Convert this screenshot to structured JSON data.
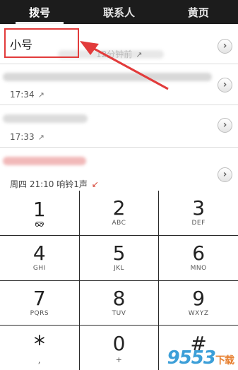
{
  "tabs": [
    {
      "label": "拨号"
    },
    {
      "label": "联系人"
    },
    {
      "label": "黄页"
    }
  ],
  "calls": [
    {
      "name": "小号",
      "detail": "12分钟前",
      "direction": "outgoing"
    },
    {
      "name": "",
      "detail": "17:34",
      "direction": "outgoing"
    },
    {
      "name": "",
      "detail": "17:33",
      "direction": "outgoing"
    },
    {
      "name": "",
      "detail": "周四 21:10 响铃1声",
      "direction": "missed"
    }
  ],
  "icons": {
    "outgoing": "↗",
    "missed": "↙",
    "chevron": "›"
  },
  "keypad": [
    {
      "digit": "1",
      "letters": ""
    },
    {
      "digit": "2",
      "letters": "ABC"
    },
    {
      "digit": "3",
      "letters": "DEF"
    },
    {
      "digit": "4",
      "letters": "GHI"
    },
    {
      "digit": "5",
      "letters": "JKL"
    },
    {
      "digit": "6",
      "letters": "MNO"
    },
    {
      "digit": "7",
      "letters": "PQRS"
    },
    {
      "digit": "8",
      "letters": "TUV"
    },
    {
      "digit": "9",
      "letters": "WXYZ"
    },
    {
      "digit": "*",
      "letters": ","
    },
    {
      "digit": "0",
      "letters": "+"
    },
    {
      "digit": "#",
      "letters": ""
    }
  ],
  "watermark": {
    "main": "9553",
    "suffix": "下载"
  },
  "colors": {
    "annotation": "#e23b3b",
    "missed": "#d43a2a"
  }
}
